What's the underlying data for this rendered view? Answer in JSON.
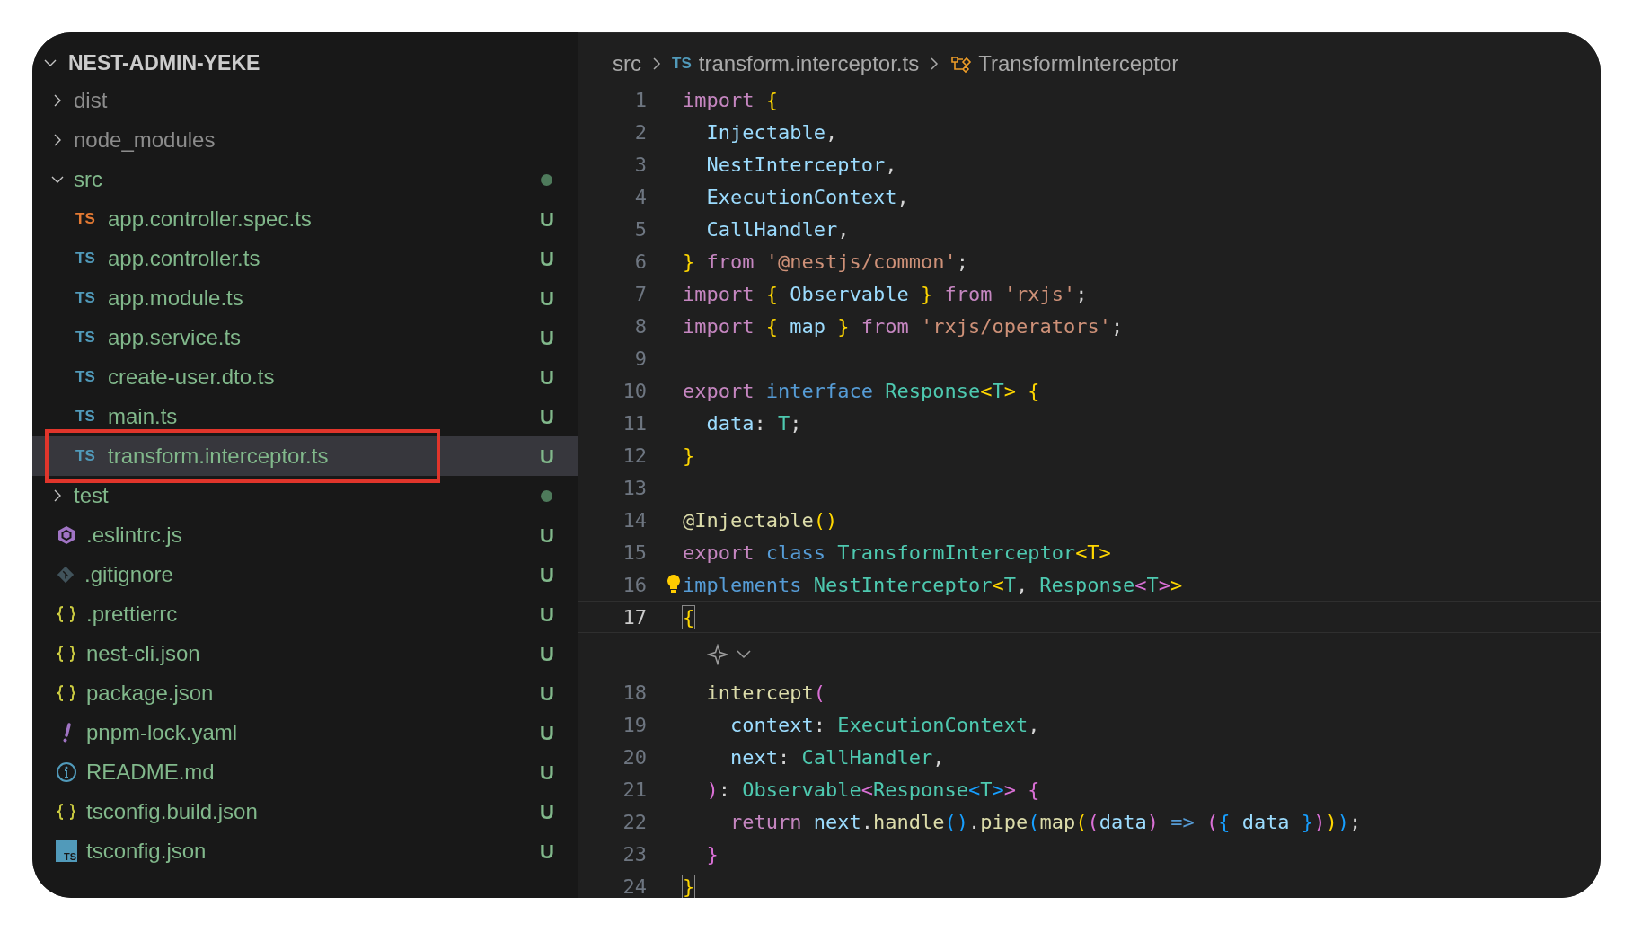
{
  "explorer": {
    "root": {
      "name": "NEST-ADMIN-YEKE",
      "expanded": true,
      "children": [
        {
          "kind": "folder",
          "name": "dist",
          "expanded": false,
          "ignored": true,
          "changes_inside": false,
          "selected": false
        },
        {
          "kind": "folder",
          "name": "node_modules",
          "expanded": false,
          "ignored": true,
          "changes_inside": false,
          "selected": false
        },
        {
          "kind": "folder",
          "name": "src",
          "expanded": true,
          "ignored": false,
          "changes_inside": true,
          "selected": false,
          "children": [
            {
              "kind": "ts",
              "badge": "TS",
              "color": "#e37933",
              "name": "app.controller.spec.ts",
              "ignored": false,
              "status": "U",
              "selected": false
            },
            {
              "kind": "ts",
              "badge": "TS",
              "color": "#519aba",
              "name": "app.controller.ts",
              "ignored": false,
              "status": "U",
              "selected": false
            },
            {
              "kind": "ts",
              "badge": "TS",
              "color": "#519aba",
              "name": "app.module.ts",
              "ignored": false,
              "status": "U",
              "selected": false
            },
            {
              "kind": "ts",
              "badge": "TS",
              "color": "#519aba",
              "name": "app.service.ts",
              "ignored": false,
              "status": "U",
              "selected": false
            },
            {
              "kind": "ts",
              "badge": "TS",
              "color": "#519aba",
              "name": "create-user.dto.ts",
              "ignored": false,
              "status": "U",
              "selected": false
            },
            {
              "kind": "ts",
              "badge": "TS",
              "color": "#519aba",
              "name": "main.ts",
              "ignored": false,
              "status": "U",
              "selected": false
            },
            {
              "kind": "ts",
              "badge": "TS",
              "color": "#519aba",
              "name": "transform.interceptor.ts",
              "ignored": false,
              "status": "U",
              "selected": true,
              "annotated": true
            }
          ]
        },
        {
          "kind": "folder",
          "name": "test",
          "expanded": false,
          "ignored": false,
          "changes_inside": true,
          "selected": false
        },
        {
          "kind": "eslint",
          "name": ".eslintrc.js",
          "ignored": false,
          "status": "U",
          "selected": false
        },
        {
          "kind": "git",
          "name": ".gitignore",
          "ignored": false,
          "status": "U",
          "selected": false
        },
        {
          "kind": "json",
          "name": ".prettierrc",
          "ignored": false,
          "status": "U",
          "selected": false
        },
        {
          "kind": "json",
          "name": "nest-cli.json",
          "ignored": false,
          "status": "U",
          "selected": false
        },
        {
          "kind": "json",
          "name": "package.json",
          "ignored": false,
          "status": "U",
          "selected": false
        },
        {
          "kind": "yaml",
          "name": "pnpm-lock.yaml",
          "ignored": false,
          "status": "U",
          "selected": false
        },
        {
          "kind": "info",
          "name": "README.md",
          "ignored": false,
          "status": "U",
          "selected": false
        },
        {
          "kind": "json",
          "name": "tsconfig.build.json",
          "ignored": false,
          "status": "U",
          "selected": false
        },
        {
          "kind": "tsconfig",
          "badge": "TS",
          "name": "tsconfig.json",
          "ignored": false,
          "status": "U",
          "selected": false
        }
      ]
    }
  },
  "breadcrumbs": [
    {
      "kind": "folder",
      "label": "src"
    },
    {
      "kind": "file",
      "badge": "TS",
      "label": "transform.interceptor.ts"
    },
    {
      "kind": "class",
      "label": "TransformInterceptor"
    }
  ],
  "editor": {
    "lines": [
      {
        "number": "1",
        "current": false,
        "tokens": [
          {
            "text": "import",
            "kind": "keyword"
          },
          {
            "text": " {",
            "kind": "brace"
          }
        ]
      },
      {
        "number": "2",
        "current": false,
        "tokens": [
          {
            "text": "  Injectable",
            "kind": "variable"
          },
          {
            "text": ",",
            "kind": "plain"
          }
        ]
      },
      {
        "number": "3",
        "current": false,
        "tokens": [
          {
            "text": "  NestInterceptor",
            "kind": "variable"
          },
          {
            "text": ",",
            "kind": "plain"
          }
        ]
      },
      {
        "number": "4",
        "current": false,
        "tokens": [
          {
            "text": "  ExecutionContext",
            "kind": "variable"
          },
          {
            "text": ",",
            "kind": "plain"
          }
        ]
      },
      {
        "number": "5",
        "current": false,
        "tokens": [
          {
            "text": "  CallHandler",
            "kind": "variable"
          },
          {
            "text": ",",
            "kind": "plain"
          }
        ]
      },
      {
        "number": "6",
        "current": false,
        "tokens": [
          {
            "text": "}",
            "kind": "brace"
          },
          {
            "text": " from",
            "kind": "keyword"
          },
          {
            "text": " '@nestjs/common'",
            "kind": "string"
          },
          {
            "text": ";",
            "kind": "plain"
          }
        ]
      },
      {
        "number": "7",
        "current": false,
        "tokens": [
          {
            "text": "import",
            "kind": "keyword"
          },
          {
            "text": " {",
            "kind": "brace"
          },
          {
            "text": " Observable",
            "kind": "variable"
          },
          {
            "text": " }",
            "kind": "brace"
          },
          {
            "text": " from",
            "kind": "keyword"
          },
          {
            "text": " 'rxjs'",
            "kind": "string"
          },
          {
            "text": ";",
            "kind": "plain"
          }
        ]
      },
      {
        "number": "8",
        "current": false,
        "tokens": [
          {
            "text": "import",
            "kind": "keyword"
          },
          {
            "text": " {",
            "kind": "brace"
          },
          {
            "text": " map",
            "kind": "variable"
          },
          {
            "text": " }",
            "kind": "brace"
          },
          {
            "text": " from",
            "kind": "keyword"
          },
          {
            "text": " 'rxjs/operators'",
            "kind": "string"
          },
          {
            "text": ";",
            "kind": "plain"
          }
        ]
      },
      {
        "number": "9",
        "current": false
      },
      {
        "number": "10",
        "current": false,
        "tokens": [
          {
            "text": "export",
            "kind": "keyword"
          },
          {
            "text": " interface",
            "kind": "storage"
          },
          {
            "text": " Response",
            "kind": "type"
          },
          {
            "text": "<",
            "kind": "brace"
          },
          {
            "text": "T",
            "kind": "type"
          },
          {
            "text": ">",
            "kind": "brace"
          },
          {
            "text": " {",
            "kind": "brace"
          }
        ]
      },
      {
        "number": "11",
        "current": false,
        "tokens": [
          {
            "text": "  data",
            "kind": "variable"
          },
          {
            "text": ":",
            "kind": "plain"
          },
          {
            "text": " T",
            "kind": "type"
          },
          {
            "text": ";",
            "kind": "plain"
          }
        ]
      },
      {
        "number": "12",
        "current": false,
        "tokens": [
          {
            "text": "}",
            "kind": "brace"
          }
        ]
      },
      {
        "number": "13",
        "current": false
      },
      {
        "number": "14",
        "current": false,
        "tokens": [
          {
            "text": "@Injectable",
            "kind": "function"
          },
          {
            "text": "()",
            "kind": "brace"
          }
        ]
      },
      {
        "number": "15",
        "current": false,
        "tokens": [
          {
            "text": "export",
            "kind": "keyword"
          },
          {
            "text": " class",
            "kind": "storage"
          },
          {
            "text": " TransformInterceptor",
            "kind": "type"
          },
          {
            "text": "<T>",
            "kind": "brace"
          }
        ]
      },
      {
        "number": "16",
        "current": false,
        "lightbulb": true,
        "tokens": [
          {
            "text": "implements",
            "kind": "storage"
          },
          {
            "text": " NestInterceptor",
            "kind": "type"
          },
          {
            "text": "<",
            "kind": "brace"
          },
          {
            "text": "T",
            "kind": "type"
          },
          {
            "text": ",",
            "kind": "plain"
          },
          {
            "text": " Response",
            "kind": "type"
          },
          {
            "text": "<",
            "kind": "purple"
          },
          {
            "text": "T",
            "kind": "type"
          },
          {
            "text": ">",
            "kind": "purple"
          },
          {
            "text": ">",
            "kind": "brace"
          }
        ]
      },
      {
        "number": "17",
        "current": true,
        "hint": true,
        "tokens": [
          {
            "text": "{",
            "kind": "matched"
          }
        ]
      },
      {
        "number": "18",
        "current": false,
        "tokens": [
          {
            "text": "  intercept",
            "kind": "function"
          },
          {
            "text": "(",
            "kind": "purple"
          }
        ]
      },
      {
        "number": "19",
        "current": false,
        "tokens": [
          {
            "text": "    context",
            "kind": "variable"
          },
          {
            "text": ":",
            "kind": "plain"
          },
          {
            "text": " ExecutionContext",
            "kind": "type"
          },
          {
            "text": ",",
            "kind": "plain"
          }
        ]
      },
      {
        "number": "20",
        "current": false,
        "tokens": [
          {
            "text": "    next",
            "kind": "variable"
          },
          {
            "text": ":",
            "kind": "plain"
          },
          {
            "text": " CallHandler",
            "kind": "type"
          },
          {
            "text": ",",
            "kind": "plain"
          }
        ]
      },
      {
        "number": "21",
        "current": false,
        "tokens": [
          {
            "text": "  )",
            "kind": "purple"
          },
          {
            "text": ":",
            "kind": "plain"
          },
          {
            "text": " Observable",
            "kind": "type"
          },
          {
            "text": "<",
            "kind": "purple"
          },
          {
            "text": "Response",
            "kind": "type"
          },
          {
            "text": "<",
            "kind": "blue"
          },
          {
            "text": "T",
            "kind": "type"
          },
          {
            "text": ">",
            "kind": "blue"
          },
          {
            "text": ">",
            "kind": "purple"
          },
          {
            "text": " {",
            "kind": "purple"
          }
        ]
      },
      {
        "number": "22",
        "current": false,
        "tokens": [
          {
            "text": "    return",
            "kind": "keyword"
          },
          {
            "text": " next",
            "kind": "variable"
          },
          {
            "text": ".",
            "kind": "plain"
          },
          {
            "text": "handle",
            "kind": "function"
          },
          {
            "text": "()",
            "kind": "blue"
          },
          {
            "text": ".",
            "kind": "plain"
          },
          {
            "text": "pipe",
            "kind": "function"
          },
          {
            "text": "(",
            "kind": "blue"
          },
          {
            "text": "map",
            "kind": "function"
          },
          {
            "text": "(",
            "kind": "brace"
          },
          {
            "text": "(",
            "kind": "purple"
          },
          {
            "text": "data",
            "kind": "variable"
          },
          {
            "text": ")",
            "kind": "purple"
          },
          {
            "text": " =>",
            "kind": "storage"
          },
          {
            "text": " (",
            "kind": "purple"
          },
          {
            "text": "{",
            "kind": "blue"
          },
          {
            "text": " data",
            "kind": "variable"
          },
          {
            "text": " }",
            "kind": "blue"
          },
          {
            "text": ")",
            "kind": "purple"
          },
          {
            "text": ")",
            "kind": "brace"
          },
          {
            "text": ")",
            "kind": "blue"
          },
          {
            "text": ";",
            "kind": "plain"
          }
        ]
      },
      {
        "number": "23",
        "current": false,
        "tokens": [
          {
            "text": "  }",
            "kind": "purple"
          }
        ]
      },
      {
        "number": "24",
        "current": false,
        "tokens": [
          {
            "text": "}",
            "kind": "matched"
          }
        ]
      }
    ]
  }
}
